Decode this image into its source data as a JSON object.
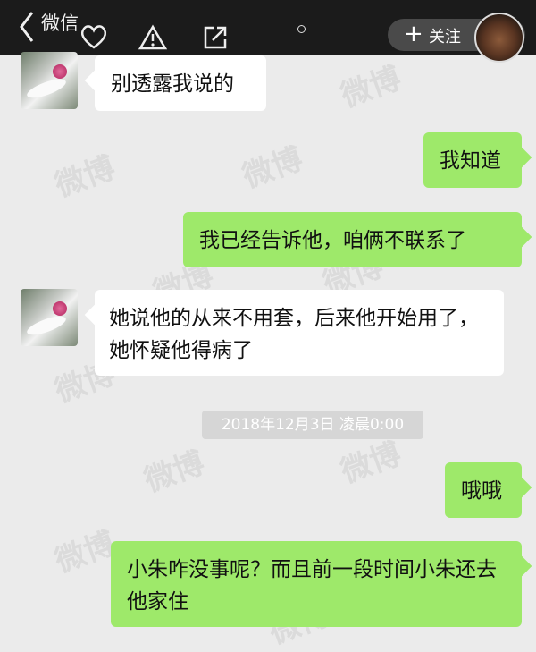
{
  "header": {
    "back_label": "微信",
    "follow_plus": "+",
    "follow_label": "关注",
    "icons": [
      "back-chevron-icon",
      "heart-icon",
      "warning-icon",
      "share-icon"
    ]
  },
  "messages": [
    {
      "side": "left",
      "text": "别透露我说的"
    },
    {
      "side": "right",
      "text": "我知道"
    },
    {
      "side": "right",
      "text": "我已经告诉他，咱俩不联系了"
    },
    {
      "side": "left",
      "text": "她说他的从来不用套，后来他开始用了，她怀疑他得病了"
    },
    {
      "side": "right",
      "text": "哦哦"
    },
    {
      "side": "right",
      "text": "小朱咋没事呢？而且前一段时间小朱还去他家住"
    }
  ],
  "timestamp": "2018年12月3日 凌晨0:00",
  "watermark": "微博",
  "colors": {
    "topbar": "#1b1b1b",
    "background": "#ebebeb",
    "bubble_right": "#9ee96a",
    "bubble_left": "#ffffff",
    "timestamp_bg": "#d6d6d6"
  }
}
